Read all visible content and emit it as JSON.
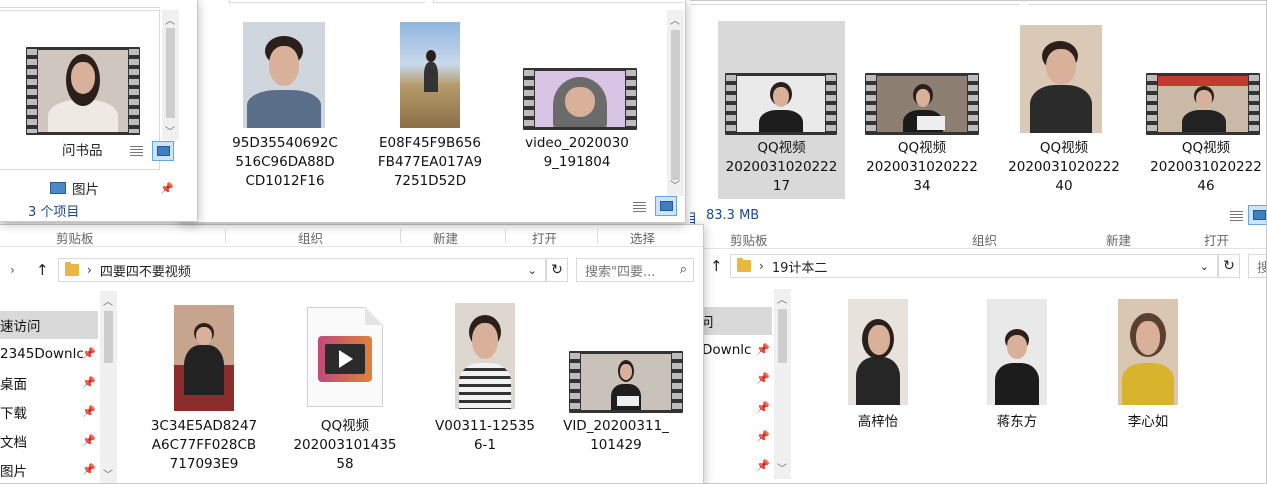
{
  "ribbon_labels": {
    "clipboard": "剪贴板",
    "organize": "组织",
    "new": "新建",
    "open": "打开",
    "select": "选择"
  },
  "back_window": {
    "items": [
      {
        "label": "QQ视频\n2020031020222\n17"
      },
      {
        "label": "QQ视频\n2020031020222\n34"
      },
      {
        "label": "QQ视频\n2020031020222\n40"
      },
      {
        "label": "QQ视频\n2020031020222\n46"
      }
    ],
    "status_size": "83.3 MB",
    "status_partial": "目",
    "path": "19计本二",
    "search_partial": "搜",
    "nav_partial": [
      "问",
      "Downlc"
    ],
    "files": [
      {
        "label": "高梓怡"
      },
      {
        "label": "蒋东方"
      },
      {
        "label": "李心如"
      }
    ]
  },
  "top_window": {
    "items": [
      {
        "label": "95D35540692C\n516C96DA88D\nCD1012F16"
      },
      {
        "label": "E08F45F9B656\nFB477EA017A9\n7251D52D"
      },
      {
        "label": "video_2020030\n9_191804"
      }
    ]
  },
  "small_window": {
    "partial_label": "问书品",
    "nav_item": "图片",
    "status": "3 个项目"
  },
  "main_window": {
    "path": "四要四不要视频",
    "search_placeholder": "搜索\"四要...",
    "nav": [
      {
        "label": "速访问"
      },
      {
        "label": "2345Downlc"
      },
      {
        "label": "桌面"
      },
      {
        "label": "下载"
      },
      {
        "label": "文档"
      },
      {
        "label": "图片"
      }
    ],
    "files": [
      {
        "label": "3C34E5AD8247\nA6C77FF028CB\n717093E9"
      },
      {
        "label": "QQ视频\n202003101435\n58"
      },
      {
        "label": "V00311-12535\n6-1"
      },
      {
        "label": "VID_20200311_\n101429"
      }
    ]
  }
}
